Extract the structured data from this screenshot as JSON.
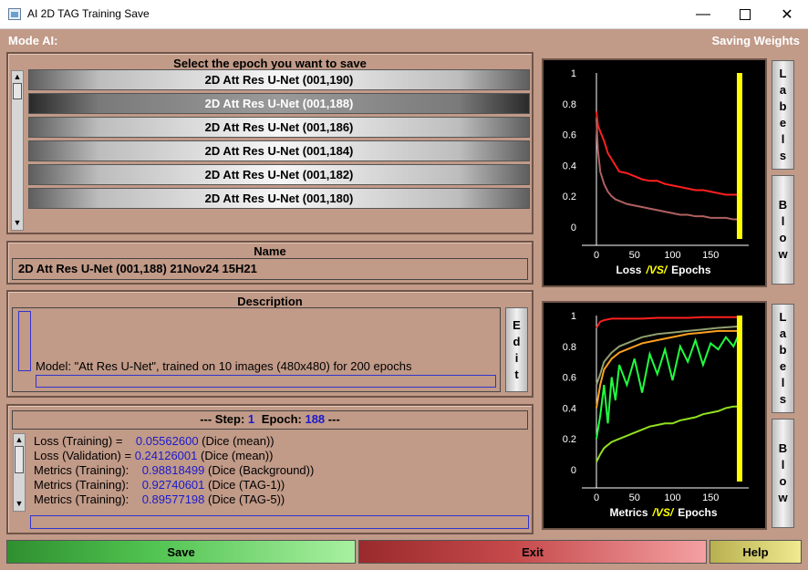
{
  "window": {
    "title": "AI 2D TAG Training Save",
    "min_icon": "minimize-icon",
    "max_icon": "maximize-icon",
    "close_icon": "close-icon"
  },
  "header": {
    "mode_label": "Mode AI:",
    "saving_label": "Saving Weights"
  },
  "epochs": {
    "title": "Select the epoch you want to save",
    "items": [
      {
        "label": "2D Att Res U-Net (001,190)",
        "selected": false
      },
      {
        "label": "2D Att Res U-Net (001,188)",
        "selected": true
      },
      {
        "label": "2D Att Res U-Net (001,186)",
        "selected": false
      },
      {
        "label": "2D Att Res U-Net (001,184)",
        "selected": false
      },
      {
        "label": "2D Att Res U-Net (001,182)",
        "selected": false
      },
      {
        "label": "2D Att Res U-Net (001,180)",
        "selected": false
      }
    ]
  },
  "name": {
    "title": "Name",
    "value": "2D Att Res U-Net (001,188) 21Nov24 15H21"
  },
  "description": {
    "title": "Description",
    "text": "Model: \"Att Res U-Net\", trained on 10 images (480x480) for 200 epochs",
    "edit_label": "Edit"
  },
  "step_info": {
    "prefix": "--- Step:",
    "step": "1",
    "epoch_label": "Epoch:",
    "epoch": "188",
    "suffix": "---"
  },
  "metrics": [
    {
      "label": "Loss (Training) =    ",
      "value": "0.05562600",
      "unit": " (Dice (mean))"
    },
    {
      "label": "Loss (Validation) = ",
      "value": "0.24126001",
      "unit": " (Dice (mean))"
    },
    {
      "label": "Metrics (Training):    ",
      "value": "0.98818499",
      "unit": " (Dice (Background))"
    },
    {
      "label": "Metrics (Training):    ",
      "value": "0.92740601",
      "unit": " (Dice (TAG-1))"
    },
    {
      "label": "Metrics (Training):    ",
      "value": "0.89577198",
      "unit": " (Dice (TAG-5))"
    }
  ],
  "side_buttons": {
    "labels": "Labels",
    "blow": "Blow"
  },
  "bottom": {
    "save": "Save",
    "exit": "Exit",
    "help": "Help"
  },
  "colors": {
    "background": "#c19a88",
    "save": "#3cb043",
    "exit": "#c0393b",
    "help": "#e8e070",
    "highlight": "#ffff00"
  },
  "chart_data": [
    {
      "type": "line",
      "title_parts": [
        "Loss",
        "/VS/",
        "Epochs"
      ],
      "xlim": [
        0,
        200
      ],
      "ylim": [
        0,
        1
      ],
      "xticks": [
        0,
        50,
        100,
        150
      ],
      "yticks": [
        0,
        0.2,
        0.4,
        0.6,
        0.8,
        1
      ],
      "marker_epoch": 188,
      "series": [
        {
          "color": "#ff2020",
          "x": [
            0,
            2,
            5,
            10,
            15,
            20,
            25,
            30,
            40,
            50,
            60,
            70,
            80,
            90,
            100,
            110,
            120,
            130,
            140,
            150,
            160,
            170,
            180,
            188
          ],
          "y": [
            0.75,
            0.66,
            0.62,
            0.56,
            0.48,
            0.44,
            0.4,
            0.36,
            0.35,
            0.33,
            0.31,
            0.3,
            0.3,
            0.28,
            0.27,
            0.26,
            0.25,
            0.24,
            0.24,
            0.23,
            0.22,
            0.21,
            0.21,
            0.21
          ]
        },
        {
          "color": "#b06060",
          "x": [
            0,
            2,
            5,
            10,
            15,
            20,
            25,
            30,
            40,
            50,
            60,
            70,
            80,
            90,
            100,
            110,
            120,
            130,
            140,
            150,
            160,
            170,
            180,
            188
          ],
          "y": [
            0.7,
            0.5,
            0.36,
            0.28,
            0.23,
            0.2,
            0.18,
            0.17,
            0.15,
            0.14,
            0.13,
            0.12,
            0.11,
            0.1,
            0.09,
            0.08,
            0.08,
            0.07,
            0.07,
            0.06,
            0.06,
            0.06,
            0.05,
            0.05
          ]
        }
      ]
    },
    {
      "type": "line",
      "title_parts": [
        "Metrics",
        "/VS/",
        "Epochs"
      ],
      "xlim": [
        0,
        200
      ],
      "ylim": [
        0,
        1
      ],
      "xticks": [
        0,
        50,
        100,
        150
      ],
      "yticks": [
        0,
        0.2,
        0.4,
        0.6,
        0.8,
        1
      ],
      "marker_epoch": 188,
      "series": [
        {
          "color": "#ff2020",
          "x": [
            0,
            5,
            10,
            20,
            40,
            60,
            80,
            100,
            120,
            140,
            160,
            188
          ],
          "y": [
            0.92,
            0.96,
            0.97,
            0.98,
            0.98,
            0.98,
            0.985,
            0.985,
            0.985,
            0.99,
            0.99,
            0.99
          ]
        },
        {
          "color": "#ffa020",
          "x": [
            0,
            5,
            10,
            20,
            30,
            40,
            60,
            80,
            100,
            120,
            140,
            160,
            188
          ],
          "y": [
            0.4,
            0.55,
            0.65,
            0.72,
            0.76,
            0.78,
            0.82,
            0.84,
            0.86,
            0.88,
            0.89,
            0.9,
            0.9
          ]
        },
        {
          "color": "#8fa070",
          "x": [
            0,
            5,
            10,
            20,
            30,
            40,
            60,
            80,
            100,
            120,
            140,
            160,
            188
          ],
          "y": [
            0.55,
            0.62,
            0.7,
            0.76,
            0.8,
            0.82,
            0.86,
            0.88,
            0.89,
            0.9,
            0.91,
            0.92,
            0.93
          ]
        },
        {
          "color": "#20ff40",
          "x": [
            0,
            5,
            10,
            15,
            20,
            25,
            30,
            40,
            50,
            60,
            70,
            80,
            90,
            100,
            110,
            120,
            130,
            140,
            150,
            160,
            170,
            180,
            188
          ],
          "y": [
            0.2,
            0.35,
            0.55,
            0.3,
            0.6,
            0.45,
            0.68,
            0.55,
            0.72,
            0.5,
            0.75,
            0.62,
            0.78,
            0.58,
            0.8,
            0.7,
            0.84,
            0.68,
            0.82,
            0.78,
            0.86,
            0.8,
            0.89
          ]
        },
        {
          "color": "#90e020",
          "x": [
            0,
            5,
            10,
            15,
            20,
            30,
            40,
            50,
            60,
            70,
            80,
            90,
            100,
            110,
            120,
            130,
            140,
            150,
            160,
            170,
            180,
            188
          ],
          "y": [
            0.05,
            0.1,
            0.14,
            0.16,
            0.18,
            0.2,
            0.22,
            0.24,
            0.26,
            0.28,
            0.29,
            0.3,
            0.3,
            0.32,
            0.33,
            0.34,
            0.36,
            0.37,
            0.38,
            0.4,
            0.41,
            0.41
          ]
        }
      ]
    }
  ]
}
